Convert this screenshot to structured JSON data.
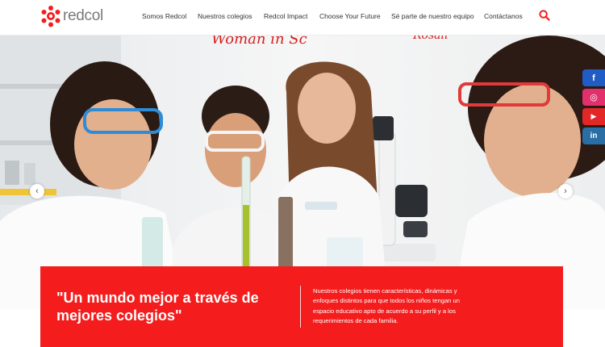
{
  "brand": {
    "logo_text": "redcol",
    "accent_color": "#f41c1c"
  },
  "nav": {
    "items": [
      {
        "label": "Somos Redcol"
      },
      {
        "label": "Nuestros colegios"
      },
      {
        "label": "Redcol Impact"
      },
      {
        "label": "Choose Your Future"
      },
      {
        "label": "Sé parte de nuestro equipo"
      },
      {
        "label": "Contáctanos"
      }
    ],
    "search_icon": "search-icon"
  },
  "hero": {
    "board_text_left": "Woman in Sc",
    "board_text_right": "Rosali",
    "prev_icon": "chevron-left-icon",
    "next_icon": "chevron-right-icon"
  },
  "banner": {
    "quote": "\"Un mundo mejor a través de mejores colegios\"",
    "description": "Nuestros colegios tienen características, dinámicas y enfoques distintos para que todos los niños tengan un espacio educativo apto de acuerdo a su perfil y a los requerimientos de cada familia."
  },
  "social": [
    {
      "name": "facebook-icon",
      "glyph": "f",
      "color": "#1f5cc4"
    },
    {
      "name": "instagram-icon",
      "glyph": "◎",
      "color": "#e1306c"
    },
    {
      "name": "youtube-icon",
      "glyph": "▶",
      "color": "#e32727"
    },
    {
      "name": "linkedin-icon",
      "glyph": "in",
      "color": "#2a6ea6"
    }
  ]
}
